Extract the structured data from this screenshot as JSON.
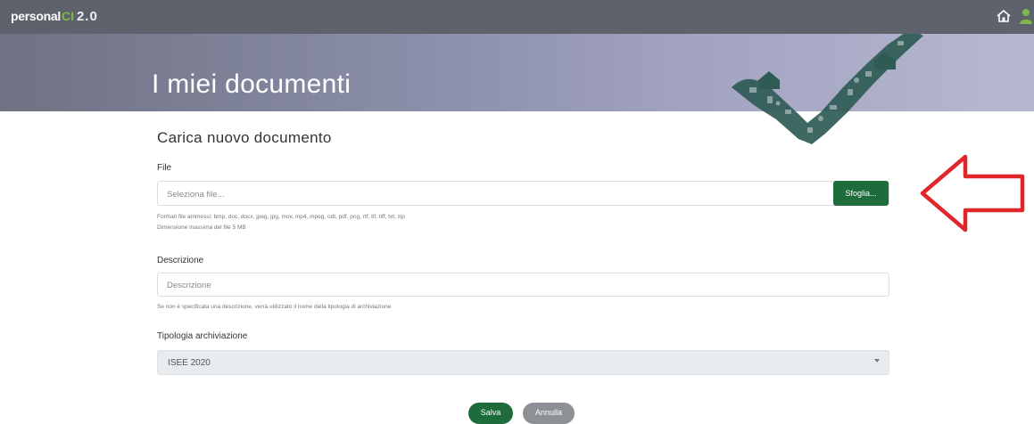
{
  "app": {
    "brand_personal": "personal",
    "brand_mark": "CI",
    "brand_version": "2.0"
  },
  "header": {
    "title": "I miei documenti",
    "home_icon": "home-icon",
    "user_icon": "user-icon"
  },
  "form": {
    "section_title": "Carica nuovo documento",
    "file": {
      "label": "File",
      "placeholder": "Seleziona file...",
      "browse_label": "Sfoglia...",
      "formats_hint": "Formati file ammessi: bmp, doc, docx, jpeg, jpg, mov, mp4, mpeg, odt, pdf, png, rtf, tif, tiff, txt, zip",
      "size_hint": "Dimensione massima del file 5 MB"
    },
    "description": {
      "label": "Descrizione",
      "placeholder": "Descrizione",
      "hint": "Se non è specificata una descrizione, verrà utilizzato il nome della tipologia di archiviazione"
    },
    "archive_type": {
      "label": "Tipologia archiviazione",
      "selected": "ISEE 2020"
    },
    "actions": {
      "save_label": "Salva",
      "cancel_label": "Annulla"
    }
  },
  "colors": {
    "accent_green": "#1e6b3c",
    "annotation_red": "#e0262b"
  }
}
